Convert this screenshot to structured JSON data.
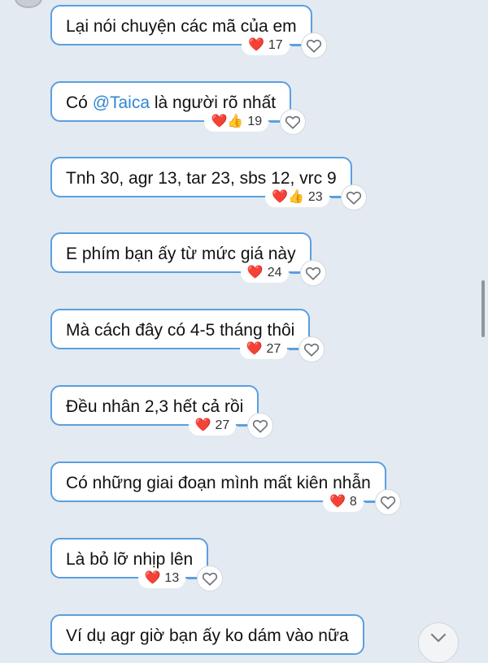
{
  "messages": [
    {
      "text": "Lại nói chuyện các mã của em",
      "reactions": "❤️",
      "count": "17"
    },
    {
      "prefix": "Có ",
      "mention": "@Taica",
      "suffix": " là người rõ nhất",
      "reactions": "❤️👍",
      "count": "19"
    },
    {
      "text": "Tnh 30, agr 13, tar 23, sbs 12, vrc 9",
      "reactions": "❤️👍",
      "count": "23"
    },
    {
      "text": "E phím bạn ấy từ mức giá này",
      "reactions": "❤️",
      "count": "24"
    },
    {
      "text": "Mà cách đây có 4-5 tháng thôi",
      "reactions": "❤️",
      "count": "27"
    },
    {
      "text": "Đều nhân 2,3 hết cả rồi",
      "reactions": "❤️",
      "count": "27"
    },
    {
      "text": "Có những giai đoạn mình mất kiên nhẫn",
      "reactions": "❤️",
      "count": "8"
    },
    {
      "text": "Là bỏ lỡ nhịp lên",
      "reactions": "❤️",
      "count": "13"
    },
    {
      "text": "Ví dụ agr giờ bạn ấy ko dám vào nữa"
    }
  ],
  "icons": {
    "react_button": "heart-outline-icon",
    "scroll_down": "chevron-down-icon"
  },
  "colors": {
    "background": "#e3eaf1",
    "bubble_border": "#5b9fe0",
    "mention": "#2f86d6",
    "heart": "#e0202e"
  }
}
